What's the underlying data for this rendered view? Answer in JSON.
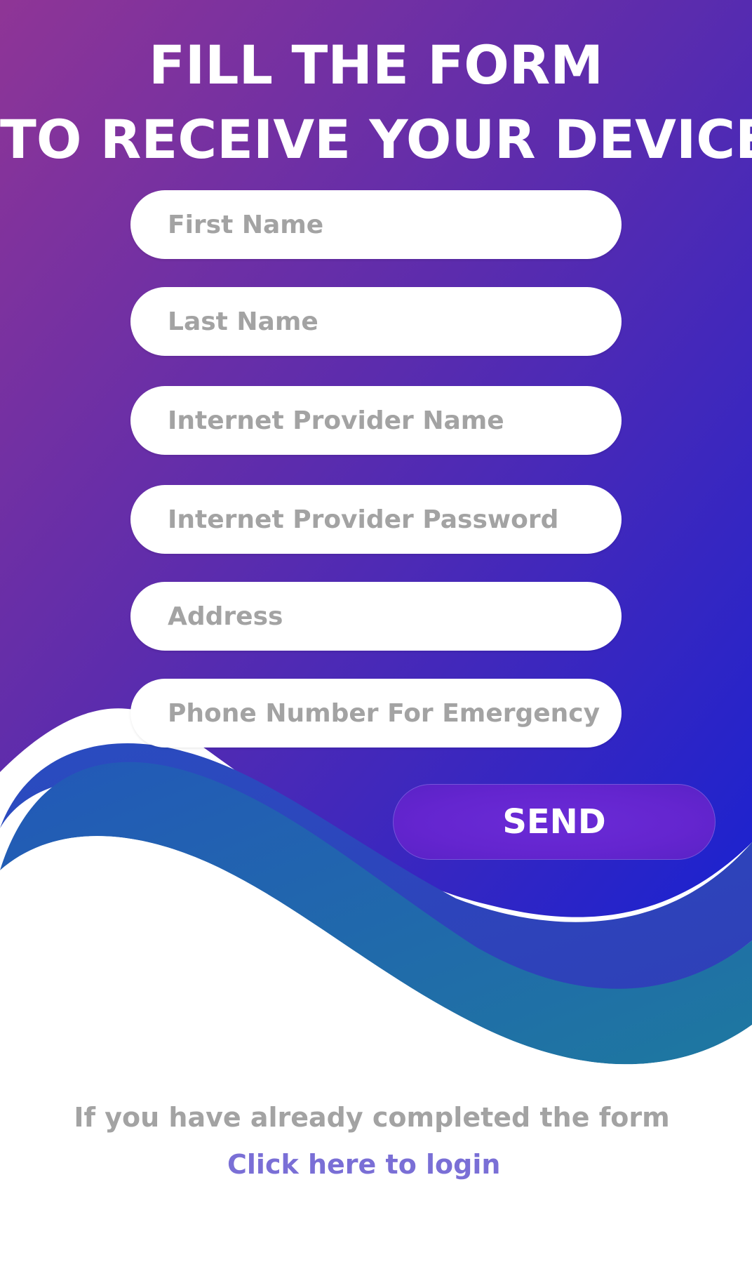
{
  "header": {
    "line1": "FILL THE FORM",
    "line2": "TO RECEIVE YOUR DEVICE"
  },
  "form": {
    "first_name": {
      "placeholder": "First Name",
      "value": ""
    },
    "last_name": {
      "placeholder": "Last Name",
      "value": ""
    },
    "provider_name": {
      "placeholder": "Internet Provider Name",
      "value": ""
    },
    "provider_password": {
      "placeholder": "Internet Provider Password",
      "value": ""
    },
    "address": {
      "placeholder": "Address",
      "value": ""
    },
    "phone": {
      "placeholder": "Phone Number For Emergency",
      "value": ""
    },
    "send_label": "SEND"
  },
  "footer": {
    "note": "If you have already completed the form",
    "login_link": "Click here to login"
  },
  "colors": {
    "gradient_top_left": "#8e3596",
    "gradient_bottom_right": "#1d22cc",
    "button": "#6425cf",
    "placeholder": "#a3a3a3",
    "link": "#7a6fd6"
  }
}
